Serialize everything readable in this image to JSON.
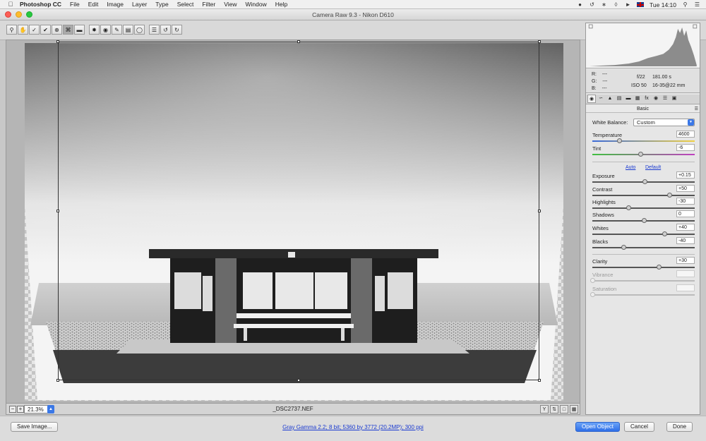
{
  "menubar": {
    "app_name": "Photoshop CC",
    "items": [
      "File",
      "Edit",
      "Image",
      "Layer",
      "Type",
      "Select",
      "Filter",
      "View",
      "Window",
      "Help"
    ],
    "clock": "Tue 14:10"
  },
  "window": {
    "title": "Camera Raw 9.3  -  Nikon D610"
  },
  "toolbar": {
    "tools": [
      "zoom-tool",
      "hand-tool",
      "white-balance-tool",
      "color-sampler-tool",
      "targeted-adjustment-tool",
      "crop-tool",
      "straighten-tool",
      "spot-removal-tool",
      "red-eye-tool",
      "adjustment-brush-tool",
      "graduated-filter-tool",
      "radial-filter-tool",
      "preferences",
      "rotate-ccw",
      "rotate-cw"
    ],
    "active_tool": "crop-tool"
  },
  "preview": {
    "zoom": "21.3%",
    "filename": "_DSC2737.NEF"
  },
  "histogram": {
    "r_label": "R:",
    "g_label": "G:",
    "b_label": "B:",
    "r_value": "---",
    "g_value": "---",
    "b_value": "---",
    "aperture": "f/22",
    "shutter": "181.00 s",
    "iso": "ISO 50",
    "lens": "16-35@22 mm"
  },
  "panel": {
    "section_title": "Basic",
    "white_balance_label": "White Balance:",
    "white_balance_value": "Custom",
    "auto_link": "Auto",
    "default_link": "Default",
    "sliders": {
      "temperature": {
        "label": "Temperature",
        "value": "4600",
        "level": 0.26
      },
      "tint": {
        "label": "Tint",
        "value": "-6",
        "level": 0.47
      },
      "exposure": {
        "label": "Exposure",
        "value": "+0.15",
        "level": 0.51
      },
      "contrast": {
        "label": "Contrast",
        "value": "+50",
        "level": 0.75
      },
      "highlights": {
        "label": "Highlights",
        "value": "-30",
        "level": 0.35
      },
      "shadows": {
        "label": "Shadows",
        "value": "0",
        "level": 0.5
      },
      "whites": {
        "label": "Whites",
        "value": "+40",
        "level": 0.7
      },
      "blacks": {
        "label": "Blacks",
        "value": "-40",
        "level": 0.3
      },
      "clarity": {
        "label": "Clarity",
        "value": "+30",
        "level": 0.65
      },
      "vibrance": {
        "label": "Vibrance",
        "value": "",
        "level": 0.0
      },
      "saturation": {
        "label": "Saturation",
        "value": "",
        "level": 0.0
      }
    }
  },
  "bottom": {
    "save_label": "Save Image...",
    "workflow_link": "Gray Gamma 2.2; 8 bit; 5360 by 3772 (20.2MP); 300 ppi",
    "open_label": "Open Object",
    "cancel_label": "Cancel",
    "done_label": "Done"
  },
  "colors": {
    "accent": "#3b78e7",
    "link": "#1a3ad0"
  }
}
